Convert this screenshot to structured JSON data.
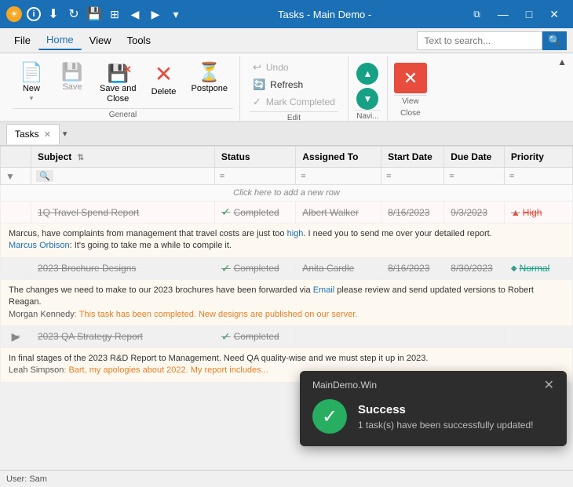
{
  "titleBar": {
    "title": "Tasks - Main Demo -",
    "icons": [
      "sun-icon",
      "info-icon",
      "download-icon",
      "refresh-icon",
      "save-icon",
      "grid-icon"
    ],
    "navPrev": "◀",
    "navNext": "▶",
    "navDropdown": "▾",
    "minimizeBtn": "—",
    "maximizeBtn": "□",
    "closeBtn": "✕"
  },
  "menuBar": {
    "items": [
      "File",
      "Home",
      "View",
      "Tools"
    ],
    "activeItem": "Home",
    "searchPlaceholder": "Text to search...",
    "searchIcon": "🔍"
  },
  "ribbon": {
    "groups": {
      "general": {
        "label": "General",
        "buttons": [
          {
            "id": "new",
            "label": "New",
            "icon": "📄",
            "hasDropdown": true
          },
          {
            "id": "save",
            "label": "Save",
            "icon": "💾",
            "disabled": true
          },
          {
            "id": "save-close",
            "label": "Save and\nClose",
            "icon": "💾",
            "hasX": true
          },
          {
            "id": "delete",
            "label": "Delete",
            "icon": "✕",
            "color": "red"
          },
          {
            "id": "postpone",
            "label": "Postpone",
            "icon": "⏳"
          }
        ]
      },
      "edit": {
        "label": "Edit",
        "items": [
          {
            "id": "undo",
            "label": "Undo",
            "disabled": true,
            "icon": "↩"
          },
          {
            "id": "refresh",
            "label": "Refresh",
            "icon": "🔄"
          },
          {
            "id": "mark-completed",
            "label": "Mark Completed",
            "disabled": true,
            "icon": "✓"
          }
        ]
      },
      "navi": {
        "label": "Navi...",
        "upBtn": "▲",
        "downBtn": "▼"
      },
      "view": {
        "label": "View",
        "closeLabel": "Close"
      }
    }
  },
  "tabs": [
    {
      "label": "Tasks",
      "active": true
    }
  ],
  "table": {
    "columns": [
      {
        "id": "subject",
        "label": "Subject",
        "hasSort": true
      },
      {
        "id": "status",
        "label": "Status"
      },
      {
        "id": "assigned",
        "label": "Assigned To"
      },
      {
        "id": "startDate",
        "label": "Start Date"
      },
      {
        "id": "dueDate",
        "label": "Due Date"
      },
      {
        "id": "priority",
        "label": "Priority"
      }
    ],
    "addRowLabel": "Click here to add a new row",
    "rows": [
      {
        "id": 1,
        "subject": "1Q Travel Spend Report",
        "status": "Completed",
        "assignedTo": "Albert Walker",
        "startDate": "8/16/2023",
        "dueDate": "9/3/2023",
        "priority": "High",
        "priorityLevel": "high",
        "strikethrough": true,
        "expanded": true,
        "expandContent": {
          "mainText": "Marcus, have complaints from management that travel costs are just too high. I need you to send me over your detailed report.",
          "linkText": "Marcus Orbison",
          "afterLink": ": It's going to take me a while to compile it."
        }
      },
      {
        "id": 2,
        "subject": "2023 Brochure Designs",
        "status": "Completed",
        "assignedTo": "Anita Cardle",
        "startDate": "8/16/2023",
        "dueDate": "8/30/2023",
        "priority": "Normal",
        "priorityLevel": "normal",
        "strikethrough": true,
        "expanded": true,
        "expandContent": {
          "mainText": "The changes we need to make to our 2023 brochures have been forwarded via Email please review and send updated versions to Robert Reagan.",
          "author": "Morgan Kennedy",
          "response": ": This task has been completed. New designs are published on our server."
        }
      },
      {
        "id": 3,
        "subject": "2023 QA Strategy Report",
        "status": "Completed",
        "assignedTo": "",
        "startDate": "",
        "dueDate": "",
        "priority": "",
        "priorityLevel": "",
        "strikethrough": true,
        "expanded": true,
        "expandContent": {
          "mainText": "In final stages of the 2023 R&D Report to Management. Need QA quality-wise and we must step it up in 2023.",
          "author": "Leah Simpson",
          "response": ": Bart, my apologies about 2022. My report includes..."
        }
      }
    ]
  },
  "toast": {
    "windowTitle": "MainDemo.Win",
    "title": "Success",
    "message": "1 task(s) have been successfully updated!",
    "closeBtn": "✕"
  },
  "statusBar": {
    "userLabel": "User: Sam"
  }
}
